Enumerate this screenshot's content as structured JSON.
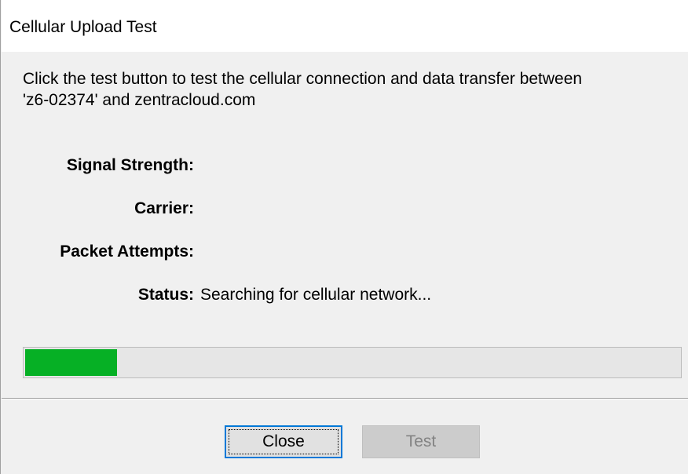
{
  "window": {
    "title": "Cellular Upload Test"
  },
  "description": {
    "line1": "Click the test button to test the cellular connection and data transfer between",
    "line2": " 'z6-02374' and zentracloud.com"
  },
  "fields": {
    "signal_strength": {
      "label": "Signal Strength:",
      "value": ""
    },
    "carrier": {
      "label": "Carrier:",
      "value": ""
    },
    "packet_attempts": {
      "label": "Packet Attempts:",
      "value": ""
    },
    "status": {
      "label": "Status:",
      "value": "Searching for cellular network..."
    }
  },
  "progress": {
    "percent": 14,
    "color": "#06b025"
  },
  "buttons": {
    "close_label": "Close",
    "test_label": "Test",
    "test_enabled": false
  }
}
